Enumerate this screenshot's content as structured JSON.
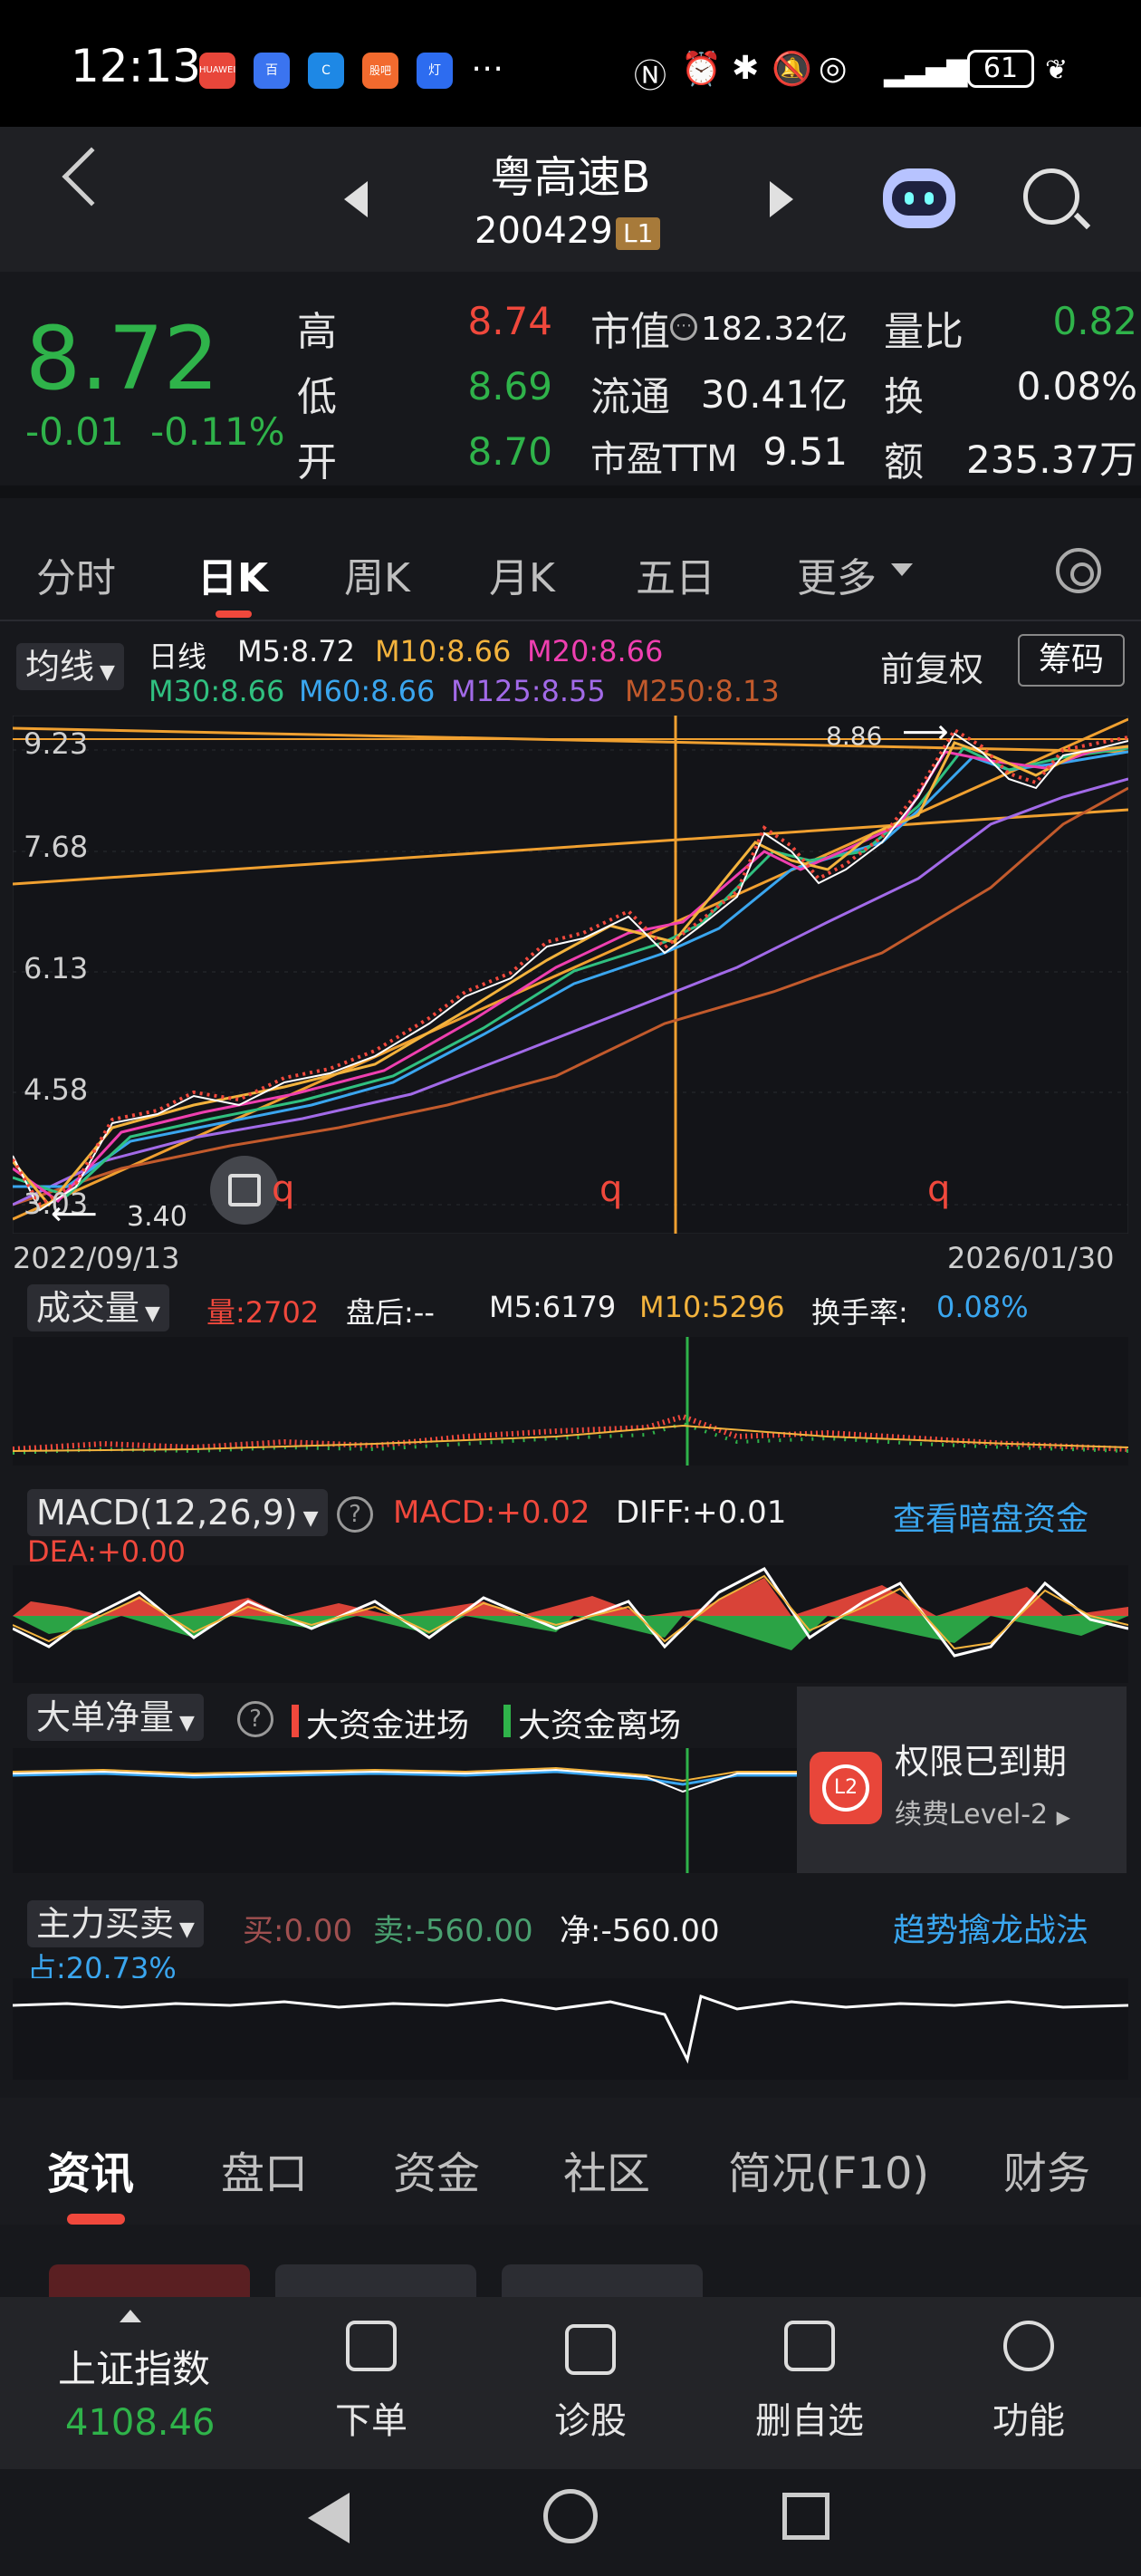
{
  "status": {
    "time": "12:13",
    "battery": "61",
    "apps": [
      "HUAWEI",
      "百",
      "C",
      "股吧",
      "灯"
    ],
    "icons": [
      "nfc-icon",
      "alarm-icon",
      "bluetooth-icon",
      "mute-icon",
      "hotspot-icon",
      "signal-icon"
    ]
  },
  "header": {
    "name": "粤高速B",
    "code": "200429",
    "level": "L1"
  },
  "quote": {
    "price": "8.72",
    "change": "-0.01",
    "change_pct": "-0.11%",
    "high_label": "高",
    "high": "8.74",
    "low_label": "低",
    "low": "8.69",
    "open_label": "开",
    "open": "8.70",
    "mcap_label": "市值",
    "mcap": "182.32亿",
    "float_label": "流通",
    "float": "30.41亿",
    "pe_label": "市盈TTM",
    "pe": "9.51",
    "vol_ratio_label": "量比",
    "vol_ratio": "0.82",
    "turnover_label": "换",
    "turnover": "0.08%",
    "amount_label": "额",
    "amount": "235.37万"
  },
  "tabs": [
    "分时",
    "日K",
    "周K",
    "月K",
    "五日",
    "更多"
  ],
  "kline": {
    "ma_select": "均线",
    "period": "日线",
    "m5": "M5:8.72",
    "m10": "M10:8.66",
    "m20": "M20:8.66",
    "m30": "M30:8.66",
    "m60": "M60:8.66",
    "m125": "M125:8.55",
    "m250": "M250:8.13",
    "adjust": "前复权",
    "chips": "筹码",
    "y_ticks": [
      "9.23",
      "7.68",
      "6.13",
      "4.58",
      "3.03"
    ],
    "high_mark": "8.86",
    "low_mark": "3.40",
    "date_start": "2022/09/13",
    "date_end": "2026/01/30",
    "q_marks": [
      "q",
      "q",
      "q"
    ]
  },
  "volume": {
    "select": "成交量",
    "vol": "量:2702",
    "after": "盘后:--",
    "m5": "M5:6179",
    "m10": "M10:5296",
    "turn_label": "换手率:",
    "turn": "0.08%"
  },
  "macd": {
    "select": "MACD(12,26,9)",
    "macd": "MACD:+0.02",
    "diff": "DIFF:+0.01",
    "dea": "DEA:+0.00",
    "link": "查看暗盘资金"
  },
  "bigorder": {
    "select": "大单净量",
    "in": "大资金进场",
    "out": "大资金离场",
    "expired": "权限已到期",
    "renew": "续费Level-2",
    "badge": "L2"
  },
  "mainforce": {
    "select": "主力买卖",
    "buy": "买:0.00",
    "sell": "卖:-560.00",
    "net": "净:-560.00",
    "pct": "占:20.73%",
    "link": "趋势擒龙战法"
  },
  "bottom_tabs": [
    "资讯",
    "盘口",
    "资金",
    "社区",
    "简况(F10)",
    "财务"
  ],
  "dock": {
    "index_name": "上证指数",
    "index_value": "4108.46",
    "items": [
      "下单",
      "诊股",
      "删自选",
      "功能"
    ]
  }
}
